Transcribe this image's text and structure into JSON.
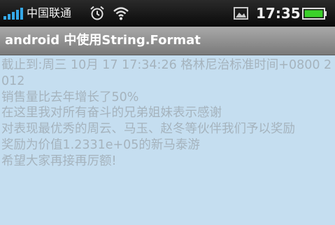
{
  "status_bar": {
    "carrier": "中国联通",
    "time": "17:35",
    "icons": [
      "signal-icon",
      "alarm-icon",
      "wifi-icon",
      "picture-icon",
      "battery-icon"
    ],
    "battery_color": "#3bd12a"
  },
  "title_bar": {
    "title": "android 中使用String.Format"
  },
  "content": {
    "line1": "截止到:周三 10月 17 17:34:26 格林尼治标准时间+0800 2012",
    "line2": "销售量比去年增长了50%",
    "line3": "在这里我对所有奋斗的兄弟姐妹表示感谢",
    "line4": "对表现最优秀的周云、马玉、赵冬等伙伴我们予以奖励",
    "line5": "奖励为价值1.2331e+05的新马泰游",
    "line6": "希望大家再接再厉额!"
  },
  "colors": {
    "background": "#c5def0",
    "text": "#a5b3bd",
    "title_text": "#ffffff"
  }
}
